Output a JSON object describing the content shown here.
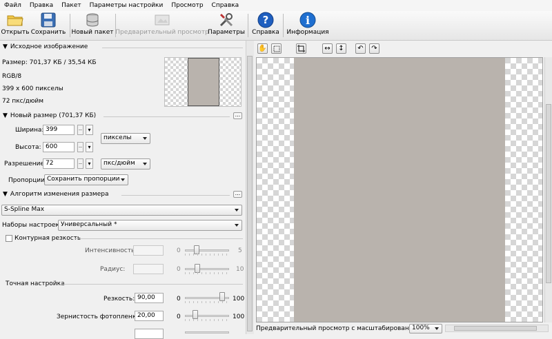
{
  "menu": [
    "Файл",
    "Правка",
    "Пакет",
    "Параметры настройки",
    "Просмотр",
    "Справка"
  ],
  "toolbar": {
    "open": "Открыть",
    "save": "Сохранить",
    "new_batch": "Новый пакет",
    "preview": "Предварительный просмотр",
    "params": "Параметры",
    "help": "Справка",
    "info": "Информация"
  },
  "source": {
    "header": "Исходное изображение",
    "size": "Размер: 701,37 КБ / 35,54 КБ",
    "mode": "RGB/8",
    "pixels": "399 x 600 пикселы",
    "dpi": "72 пкс/дюйм"
  },
  "newsize": {
    "header": "Новый размер (701,37 КБ)",
    "width_label": "Ширина:",
    "width_value": "399",
    "height_label": "Высота:",
    "height_value": "600",
    "res_label": "Разрешение:",
    "res_value": "72",
    "unit": "пикселы",
    "res_unit": "пкс/дюйм",
    "proportions_label": "Пропорции:",
    "proportions_value": "Сохранить пропорции"
  },
  "algorithm": {
    "header": "Алгоритм изменения размера",
    "method": "S-Spline Max",
    "presets_label": "Наборы настроек:",
    "presets_value": "Универсальный *",
    "contour_label": "Контурная резкость",
    "intensity_label": "Интенсивность:",
    "intensity_min": "0",
    "intensity_max": "5",
    "radius_label": "Радиус:",
    "radius_min": "0",
    "radius_max": "10"
  },
  "fine": {
    "header": "Точная настройка",
    "sharpness_label": "Резкость:",
    "sharpness_value": "90,00",
    "sharpness_level": 0.9,
    "grain_label": "Зернистость фотопленки:",
    "grain_value": "20,00",
    "grain_level": 0.2,
    "min": "0",
    "max": "100"
  },
  "preview": {
    "zoom_label": "Предварительный просмотр с масштабированием:",
    "zoom_value": "100%"
  },
  "colors": {
    "help_blue": "#1f5fbf",
    "info_blue": "#1f6fd0",
    "checker": "#d6d6d6"
  }
}
